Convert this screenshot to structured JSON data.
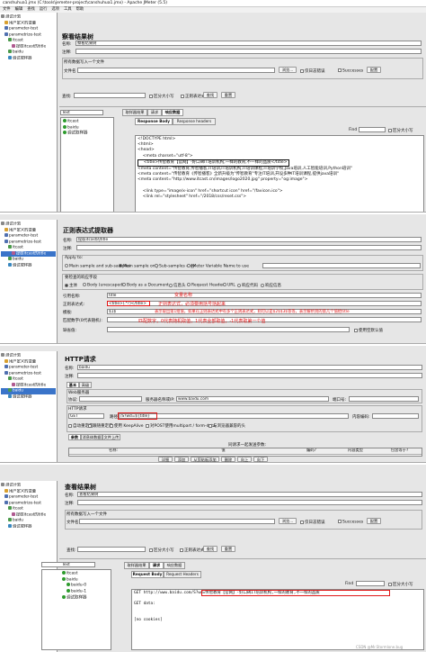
{
  "s1": {
    "title": "canshuhua1.jmx (C:\\tools\\jemeter-project\\canshuhua1.jmx) - Apache JMeter (5.5)",
    "menu": [
      "文件",
      "编辑",
      "查找",
      "运行",
      "选项",
      "工具",
      "帮助"
    ],
    "tree": [
      "测试计划",
      "用户定义的变量",
      "parameter-test",
      "parametrize-test",
      "itcast",
      "提取itcast的title",
      "baidu",
      "调试取样器"
    ],
    "heading": "察看结果树",
    "name_label": "名称:",
    "name_value": "察看结果树",
    "comment_label": "注释:",
    "file_section": "所有数据写入一个文件",
    "filename_label": "文件名",
    "browse": "浏览...",
    "log_only": "仅日志错误",
    "success_only": "Successes",
    "configure": "配置",
    "search_label": "查找:",
    "case_sensitive": "区分大小写",
    "regex": "正则表达式",
    "search_btn": "查找",
    "reset_btn": "重置",
    "render_select": "Text",
    "result_list": [
      "itcast",
      "baidu",
      "调试取样器"
    ],
    "tabs": [
      "取样器结果",
      "请求",
      "响应数据"
    ],
    "subtabs": [
      "Response Body",
      "Response headers"
    ],
    "find_label": "Find",
    "code_lines": [
      "<!DOCTYPE html>",
      "<html>",
      "<head>",
      "    <meta charset=\"utf-8\">",
      "    <title>传智教育【官网】-好口碑IT培训机构,一样的教育,不一样的品质</title>",
      "<meta content=\"传智教育,传智播客,IT培训,IT培训机构,IT培训课程,IT培训学校,Java培训,人工智能培训,Python培训\"",
      "<meta content=\"传智教育《传智播客》全新升级为\"传智教育\"专注IT培训,开设多种IT培训课程,提供java培训\"",
      "<meta content=\"http://www.itcast.cn/images/logo2020.jpg\" property=\"og:image\">",
      "",
      "    <link type=\"image/x-icon\" href=\"shortcut icon\" href=\"/favicon.ico\">",
      "    <link rel=\"stylesheet\" href=\"/2018/css/reset.css\">"
    ]
  },
  "s2": {
    "tree": [
      "测试计划",
      "用户定义的变量",
      "parameter-test",
      "parametrize-test",
      "itcast",
      "提取itcast的title",
      "baidu",
      "调试取样器"
    ],
    "heading": "正则表达式提取器",
    "name_label": "名称:",
    "name_value": "提取itcast的title",
    "comment_label": "注释:",
    "apply_to": "Apply to:",
    "apply_opts": [
      "Main sample and sub-samples",
      "Main sample only",
      "Sub-samples only",
      "JMeter Variable Name to use"
    ],
    "field_label": "要检查的响应字段",
    "field_opts": [
      "主体",
      "Body (unescaped)",
      "Body as a Document",
      "信息头",
      "Request Headers",
      "URL",
      "响应代码",
      "响应信息"
    ],
    "refname_label": "引用名称:",
    "refname_value": "title",
    "regex_label": "正则表达式:",
    "regex_value": "<title>(.*?)</title>",
    "template_label": "模板:",
    "template_value": "$1$",
    "match_label": "匹配数字(0代表随机):",
    "default_label": "缺省值:",
    "use_empty": "使用空默认值",
    "ann_name": "变量名称",
    "ann_regex": "正则表达式，必须要用括号括起来",
    "ann_template": "表示取出第1组值，如果在正则表达式中有多个正则表达式，则可以是$2$$3$等等，表示解析到的第几个值给title",
    "ann_match": "匹配数字，0代表随机取值，1代表全部取值，-1代表取第一个值"
  },
  "s3": {
    "tree": [
      "测试计划",
      "用户定义的变量",
      "parameter-test",
      "parametrize-test",
      "itcast",
      "提取itcast的title",
      "baidu",
      "调试取样器"
    ],
    "heading": "HTTP请求",
    "name_label": "名称:",
    "name_value": "baidu",
    "comment_label": "注释:",
    "tabs": [
      "基本",
      "高级"
    ],
    "web_server": "Web服务器",
    "protocol_label": "协议:",
    "server_label": "服务器名称或IP:",
    "server_value": "www.baidu.com",
    "port_label": "端口号:",
    "http_req": "HTTP请求",
    "method_value": "GET",
    "path_label": "路径:",
    "path_value": "/S?wd=${title}",
    "encoding_label": "内容编码:",
    "opts": [
      "自动重定向",
      "跟随重定向",
      "使用 KeepAlive",
      "对POST使用multipart / form-data",
      "与浏览器兼容的头"
    ],
    "tabs2": [
      "参数",
      "消息体数据",
      "文件上传"
    ],
    "send_params": "同请求一起发送参数:",
    "cols": [
      "名称:",
      "值",
      "编码?",
      "内容类型",
      "包含等于?"
    ],
    "btns": [
      "详细",
      "添加",
      "从剪贴板添加",
      "删除",
      "向上",
      "向下"
    ]
  },
  "s4": {
    "tree": [
      "测试计划",
      "用户定义的变量",
      "parameter-test",
      "parametrize-test",
      "itcast",
      "提取itcast的title",
      "baidu",
      "调试取样器"
    ],
    "heading": "查看结果树",
    "name_label": "名称:",
    "name_value": "查看结果树",
    "comment_label": "注释:",
    "file_section": "所有数据写入一个文件",
    "filename_label": "文件名",
    "browse": "浏览...",
    "log_only": "仅日志错误",
    "success_only": "Successes",
    "configure": "配置",
    "search_label": "查找:",
    "case_sensitive": "区分大小写",
    "regex": "正则表达式",
    "search_btn": "查找",
    "reset_btn": "重置",
    "render_select": "Text",
    "result_list": [
      "itcast",
      "baidu",
      "baidu-0",
      "baidu-1",
      "调试取样器"
    ],
    "tabs": [
      "取样器结果",
      "请求",
      "响应数据"
    ],
    "subtabs": [
      "Request Body",
      "Request Headers"
    ],
    "find_label": "Find",
    "code_lines": [
      "GET http://www.baidu.com/S?wd=传智教育【官网】-好口碑IT培训机构,一样的教育,不一样的品质",
      "",
      "GET data:",
      "",
      "",
      "[no cookies]"
    ],
    "watermark": "CSDN @Mr.Stormlone.bug"
  }
}
